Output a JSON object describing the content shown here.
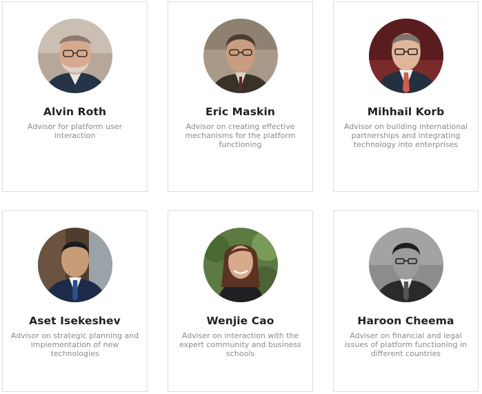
{
  "advisors": [
    {
      "name": "Alvin Roth",
      "role": "Advisor for platform user interaction",
      "photo_icon": "person-photo"
    },
    {
      "name": "Eric Maskin",
      "role": "Advisor on creating effective mechanisms for the platform functioning",
      "photo_icon": "person-photo"
    },
    {
      "name": "Mihhail Korb",
      "role": "Advisor on building international partnerships and integrating technology into enterprises",
      "photo_icon": "person-photo"
    },
    {
      "name": "Aset Isekeshev",
      "role": "Advisor on strategic planning and implementation of new technologies",
      "photo_icon": "person-photo"
    },
    {
      "name": "Wenjie Cao",
      "role": "Adviser on interaction with the expert community and business schools",
      "photo_icon": "person-photo"
    },
    {
      "name": "Haroon Cheema",
      "role": "Adviser on financial and legal issues of platform functioning in different countries",
      "photo_icon": "person-photo"
    }
  ],
  "colors": {
    "card_border": "#dcdcdc",
    "name_text": "#222222",
    "role_text": "#8a8a8a",
    "background": "#ffffff"
  }
}
